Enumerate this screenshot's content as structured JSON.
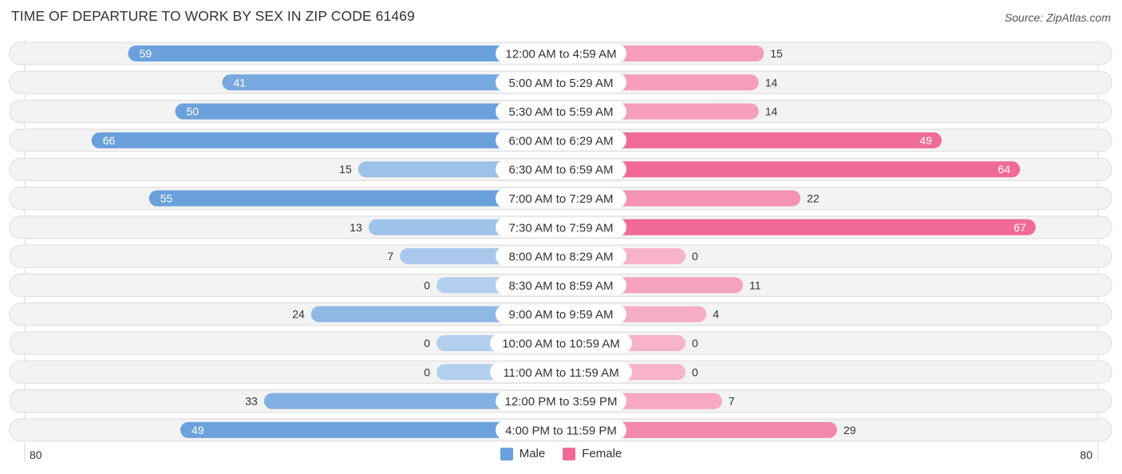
{
  "header": {
    "title": "TIME OF DEPARTURE TO WORK BY SEX IN ZIP CODE 61469",
    "source": "Source: ZipAtlas.com"
  },
  "legend": {
    "male_label": "Male",
    "female_label": "Female",
    "male_color": "#6aa0dc",
    "female_color": "#f06a95"
  },
  "chart_data": {
    "type": "bar",
    "orientation": "horizontal-butterfly",
    "title": "TIME OF DEPARTURE TO WORK BY SEX IN ZIP CODE 61469",
    "categories": [
      "12:00 AM to 4:59 AM",
      "5:00 AM to 5:29 AM",
      "5:30 AM to 5:59 AM",
      "6:00 AM to 6:29 AM",
      "6:30 AM to 6:59 AM",
      "7:00 AM to 7:29 AM",
      "7:30 AM to 7:59 AM",
      "8:00 AM to 8:29 AM",
      "8:30 AM to 8:59 AM",
      "9:00 AM to 9:59 AM",
      "10:00 AM to 10:59 AM",
      "11:00 AM to 11:59 AM",
      "12:00 PM to 3:59 PM",
      "4:00 PM to 11:59 PM"
    ],
    "series": [
      {
        "name": "Male",
        "color": "#6aa0dc",
        "values": [
          59,
          41,
          50,
          66,
          15,
          55,
          13,
          7,
          0,
          24,
          0,
          0,
          33,
          49
        ]
      },
      {
        "name": "Female",
        "color": "#f06a95",
        "values": [
          15,
          14,
          14,
          49,
          64,
          22,
          67,
          0,
          11,
          4,
          0,
          0,
          7,
          29
        ]
      }
    ],
    "axis": {
      "left_tick": "80",
      "right_tick": "80",
      "range": [
        0,
        80
      ]
    },
    "legend_position": "bottom-center"
  }
}
